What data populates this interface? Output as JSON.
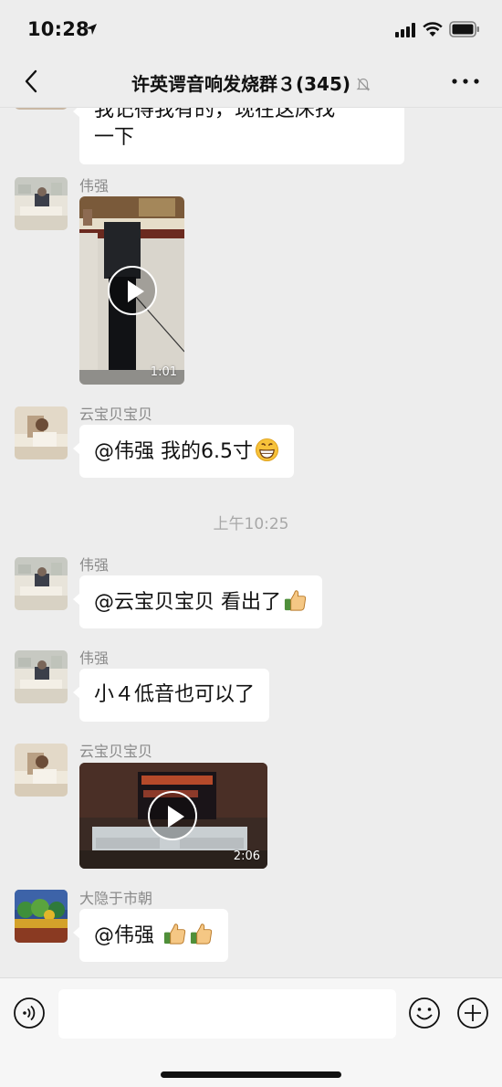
{
  "status_bar": {
    "time": "10:28"
  },
  "nav": {
    "title": "许英谔音响发烧群３(345)"
  },
  "messages": [
    {
      "text_lines": [
        "我记得我有的，现在这床找",
        "一下"
      ]
    },
    {
      "sender": "伟强",
      "video_duration": "1:01"
    },
    {
      "sender": "云宝贝宝贝",
      "text": "@伟强 我的6.5寸"
    },
    {
      "sender": "伟强",
      "text": "@云宝贝宝贝 看出了"
    },
    {
      "sender": "伟强",
      "text": "小４低音也可以了"
    },
    {
      "sender": "云宝贝宝贝",
      "video_duration": "2:06"
    },
    {
      "sender": "大隐于市朝",
      "text": "@伟强 "
    }
  ],
  "timestamp": "上午10:25",
  "input": {
    "value": "",
    "placeholder": ""
  },
  "icons": {
    "location": "location-arrow-icon",
    "signal": "cellular-signal-icon",
    "wifi": "wifi-icon",
    "battery": "battery-icon",
    "back": "chevron-left-icon",
    "mute": "bell-slash-icon",
    "more": "more-dots-icon",
    "voice": "voice-icon",
    "emoji": "smiley-icon",
    "plus": "plus-icon",
    "emoji_grin": "grinning-face-icon",
    "emoji_thumbs": "thumbs-up-icon"
  },
  "colors": {
    "background": "#ededed",
    "bubble": "#ffffff",
    "name": "#8a8a8a",
    "timestamp": "#a8a8a8"
  }
}
